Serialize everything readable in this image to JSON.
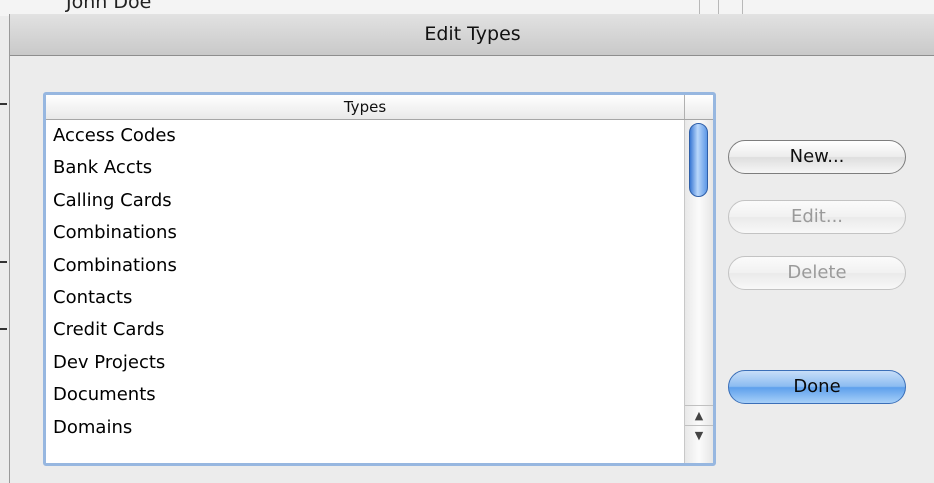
{
  "background": {
    "name_text": "John Doe"
  },
  "dialog": {
    "title": "Edit Types",
    "table": {
      "column_header": "Types",
      "rows": [
        "Access Codes",
        "Bank Accts",
        "Calling Cards",
        "Combinations",
        "Combinations",
        "Contacts",
        "Credit Cards",
        "Dev Projects",
        "Documents",
        "Domains"
      ]
    },
    "buttons": {
      "new_label": "New...",
      "edit_label": "Edit...",
      "delete_label": "Delete",
      "done_label": "Done"
    }
  },
  "colors": {
    "focus_ring": "#97b7e0",
    "default_button": "#5ea0ec",
    "scroll_thumb": "#3a78d4"
  },
  "icons": {
    "scroll_up": "triangle-up",
    "scroll_down": "triangle-down"
  }
}
